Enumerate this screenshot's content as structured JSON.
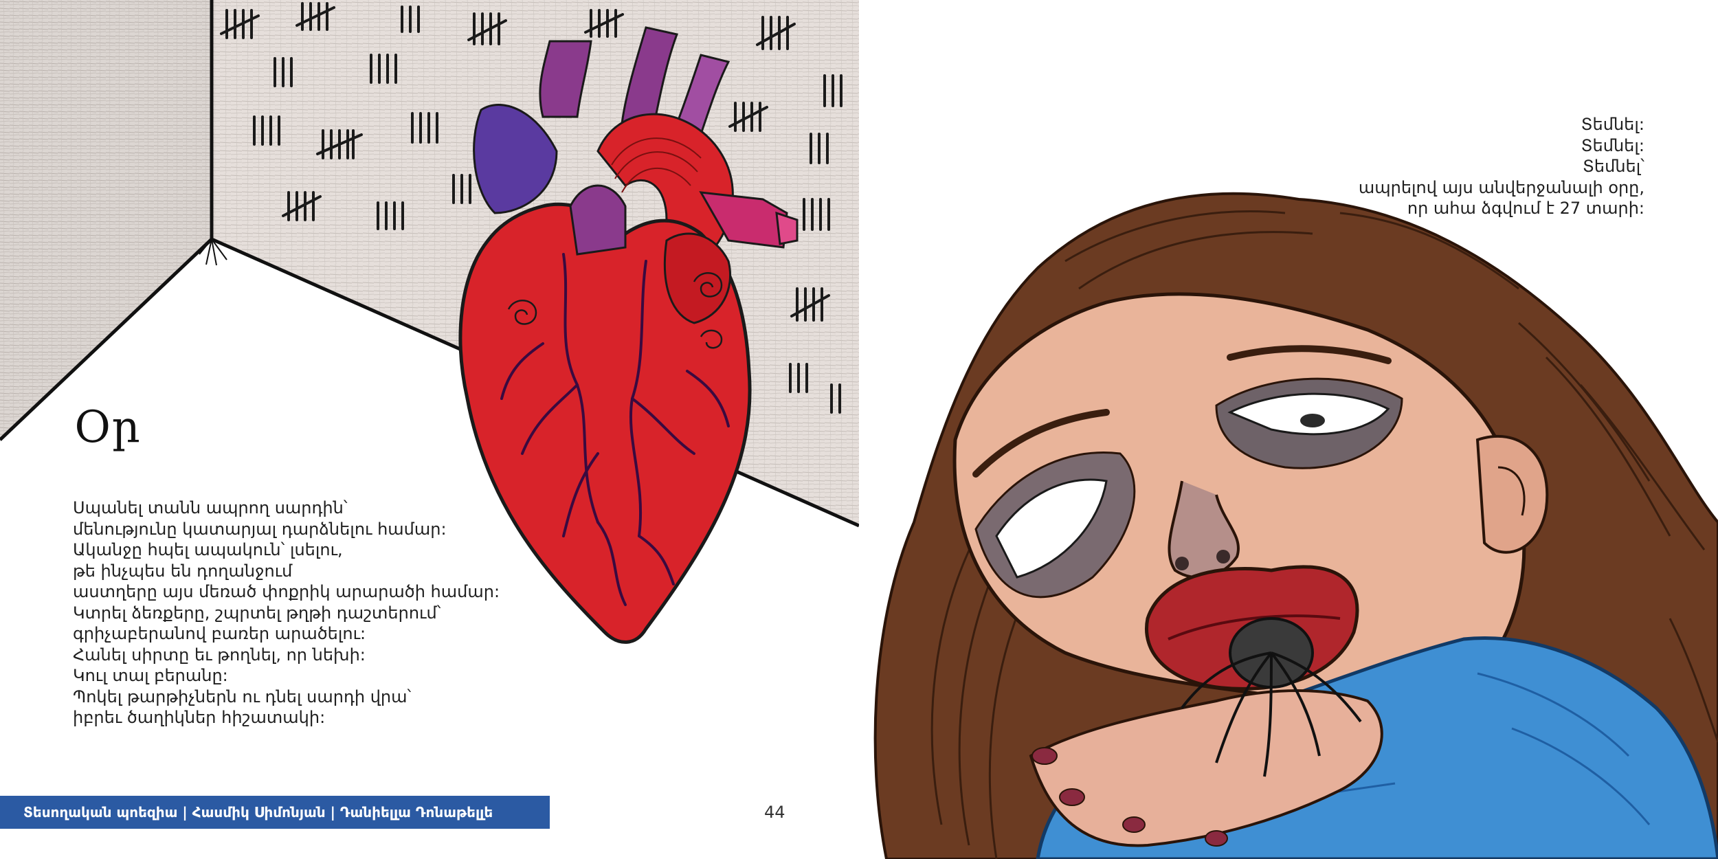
{
  "left_page": {
    "poem_title": "Օր",
    "poem_lines": [
      "Սպանել տանն ապրող սարդին՝",
      "մենությունը կատարյալ դարձնելու համար:",
      "Ականջը հպել ապակուն՝ լսելու,",
      "թե ինչպես են դողանջում",
      "աստղերը այս մեռած փոքրիկ արարածի համար:",
      "Կտրել ձեռքերը, շպրտել թղթի դաշտերում՝",
      "գրիչաբերանով բառեր արածելու:",
      "Հանել սիրտը եւ թողնել, որ նեխի:",
      "Կուլ տալ բերանը:",
      "Պոկել թարթիչներն ու դնել սարդի վրա՝",
      "իբրեւ ծաղիկներ հիշատակի:"
    ],
    "footer_label": "Տեսողական պոեզիա | Հասմիկ Սիմոնյան | Դանիելլա Դոնաթելլե",
    "page_number": "44",
    "illustration_name": "heart in tally-marked room"
  },
  "right_page": {
    "poem_lines": [
      "Տեմնել:",
      "Տեմնել:",
      "Տեմնել՝",
      "ապրելով այս անվերջանալի օրը,",
      "որ ահա ձգվում է 27 տարի:"
    ],
    "illustration_name": "woman swallowing spider"
  },
  "colors": {
    "footer_bar": "#2b5aa3",
    "heart_red": "#d8232a",
    "vessel_purple": "#8a3a8c",
    "wall_gray": "#d8d2ce",
    "hair_brown": "#6b3b22",
    "sleeve_blue": "#3f8fd3",
    "skin": "#e9b49a"
  }
}
